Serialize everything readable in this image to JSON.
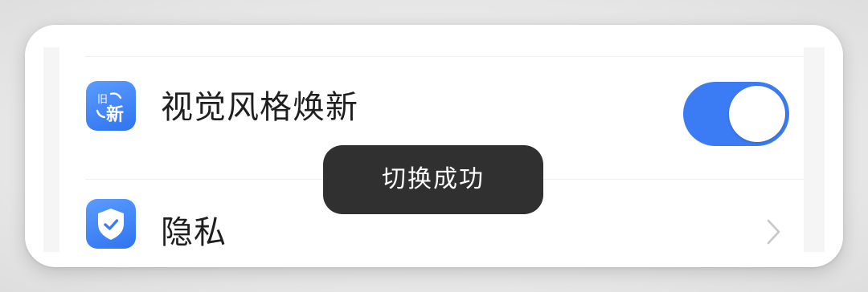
{
  "settings": {
    "items": [
      {
        "label": "视觉风格焕新",
        "icon": "old-new-style-icon",
        "icon_text_top": "旧",
        "icon_text_main": "新",
        "control": "toggle",
        "toggle_on": true
      },
      {
        "label": "隐私",
        "icon": "privacy-shield-icon",
        "control": "chevron"
      }
    ]
  },
  "toast": {
    "message": "切换成功"
  },
  "colors": {
    "accent": "#3b7bf3",
    "toast_background": "#303030",
    "label_text": "#1f1f1f",
    "chevron": "#c7c7c7"
  }
}
